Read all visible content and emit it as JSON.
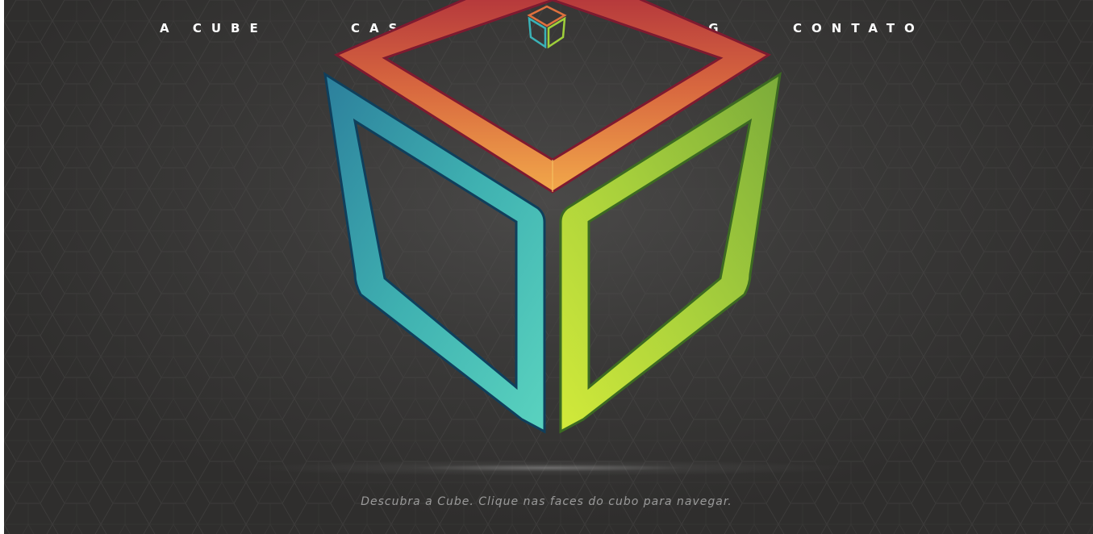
{
  "nav": {
    "items": [
      {
        "label": "A CUBE"
      },
      {
        "label": "CASES"
      },
      {
        "label": "BLOG"
      },
      {
        "label": "CONTATO"
      }
    ]
  },
  "logo": {
    "icon": "cube-logo-icon"
  },
  "hero": {
    "cube_faces": [
      {
        "name": "top",
        "color": "#c2453f",
        "accent": "#e89a45"
      },
      {
        "name": "left",
        "color": "#2f8fa3",
        "accent": "#4fcab8"
      },
      {
        "name": "right",
        "color": "#8bb83a",
        "accent": "#c9e63a"
      }
    ],
    "tagline": "Descubra a Cube. Clique nas faces do cubo para navegar."
  },
  "colors": {
    "background": "#3b3a39",
    "nav_text": "#ffffff",
    "tagline_text": "#9a9a9a"
  }
}
